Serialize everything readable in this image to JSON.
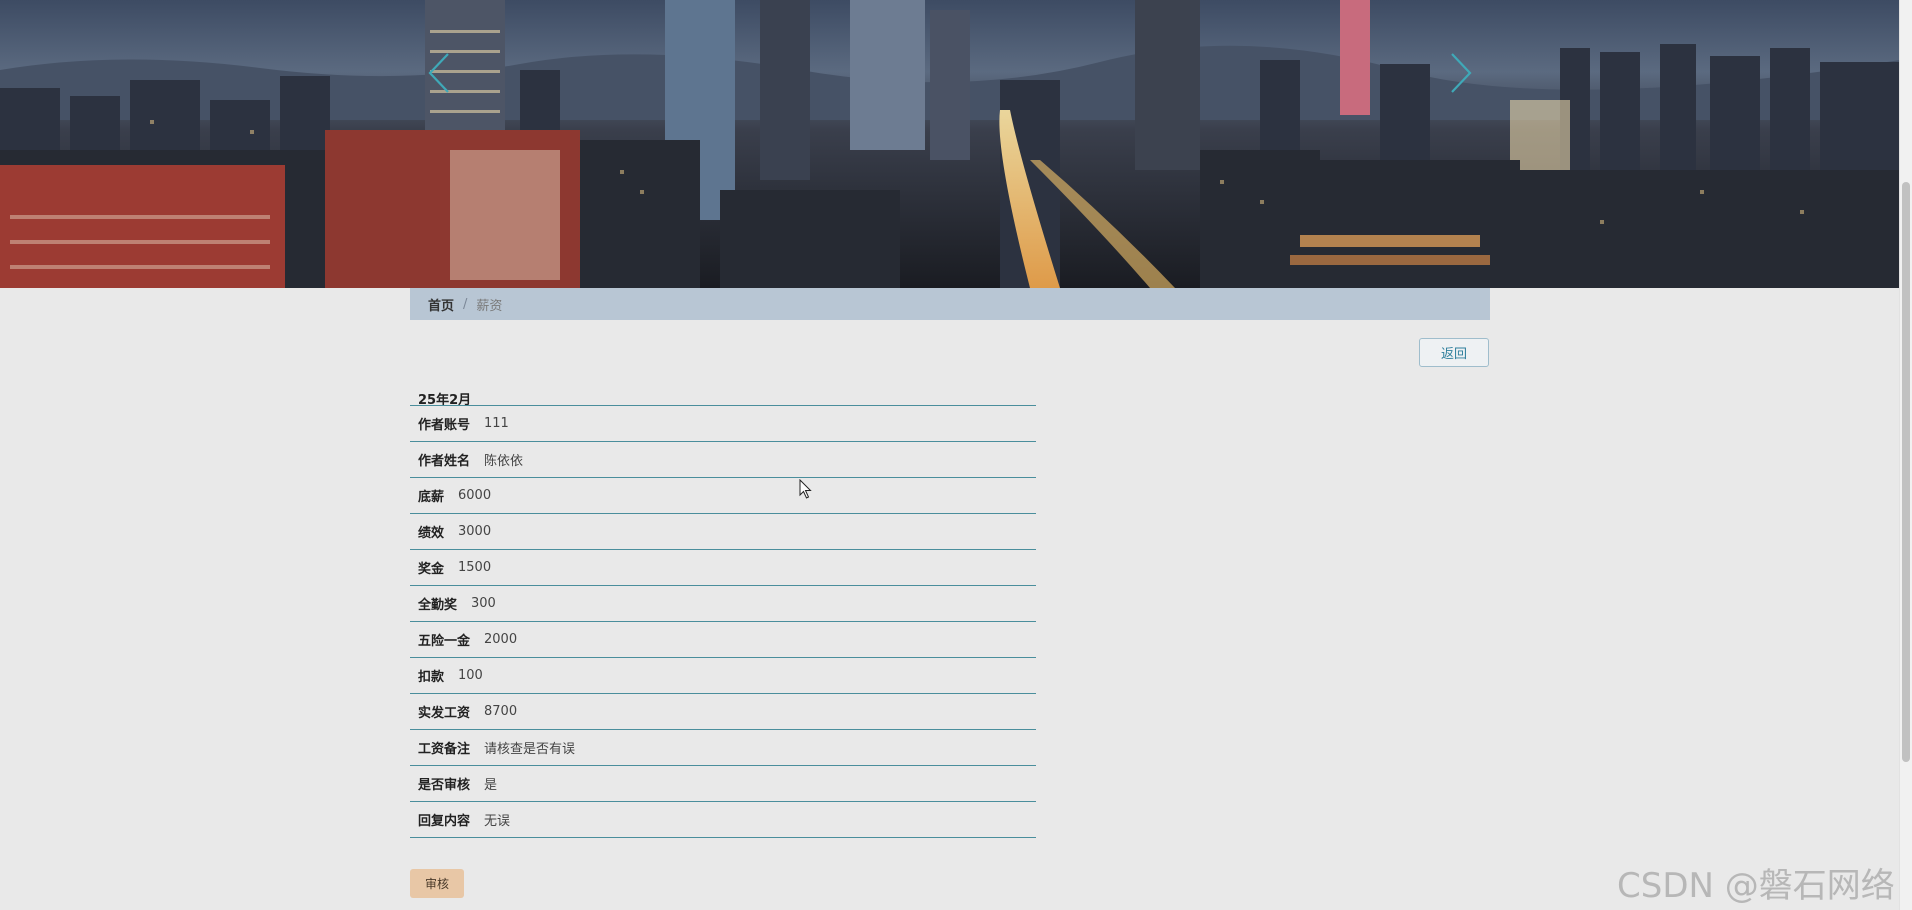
{
  "breadcrumb": {
    "home": "首页",
    "separator": "/",
    "current": "薪资"
  },
  "back_button": "返回",
  "month": "25年2月",
  "rows": [
    {
      "label": "作者账号",
      "value": "111"
    },
    {
      "label": "作者姓名",
      "value": "陈依依"
    },
    {
      "label": "底薪",
      "value": "6000"
    },
    {
      "label": "绩效",
      "value": "3000"
    },
    {
      "label": "奖金",
      "value": "1500"
    },
    {
      "label": "全勤奖",
      "value": "300"
    },
    {
      "label": "五险一金",
      "value": "2000"
    },
    {
      "label": "扣款",
      "value": "100"
    },
    {
      "label": "实发工资",
      "value": "8700"
    },
    {
      "label": "工资备注",
      "value": "请核查是否有误"
    },
    {
      "label": "是否审核",
      "value": "是"
    },
    {
      "label": "回复内容",
      "value": "无误"
    }
  ],
  "review_button": "审核",
  "watermark": "CSDN @磐石网络",
  "banner_image": "night city skyline",
  "icons": {
    "carousel_prev": "chevron-left-icon",
    "carousel_next": "chevron-right-icon"
  },
  "colors": {
    "breadcrumb_bg": "#b8c6d4",
    "row_border": "#4a8e9c",
    "review_button_bg": "#e8c7a6",
    "back_button_text": "#2e7f9c",
    "page_bg": "#e9e9e9"
  }
}
